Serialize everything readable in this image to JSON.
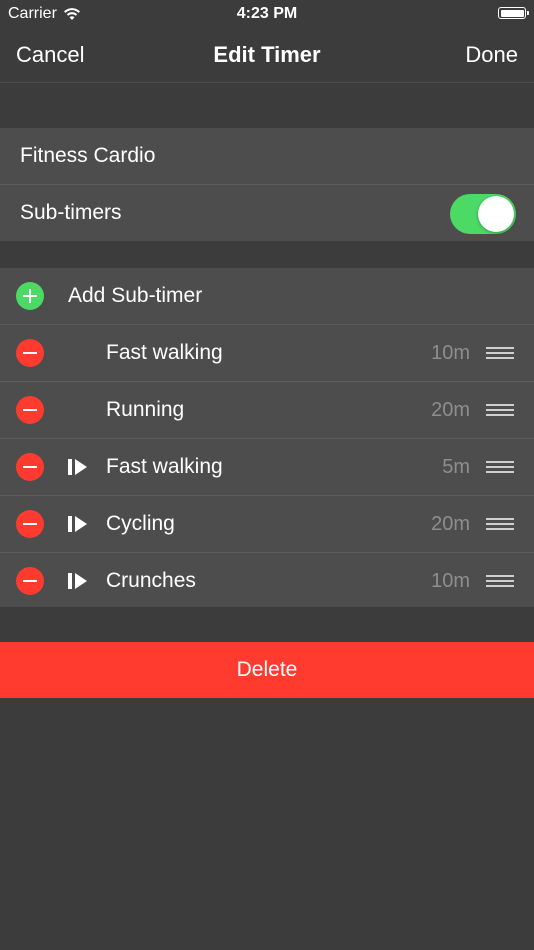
{
  "status_bar": {
    "carrier": "Carrier",
    "time": "4:23 PM"
  },
  "nav": {
    "cancel": "Cancel",
    "title": "Edit Timer",
    "done": "Done"
  },
  "settings": {
    "name": "Fitness Cardio",
    "subtimers_label": "Sub-timers",
    "subtimers_enabled": true
  },
  "subtimers": {
    "add_label": "Add Sub-timer",
    "items": [
      {
        "name": "Fast walking",
        "duration": "10m",
        "skip_icon": false
      },
      {
        "name": "Running",
        "duration": "20m",
        "skip_icon": false
      },
      {
        "name": "Fast walking",
        "duration": "5m",
        "skip_icon": true
      },
      {
        "name": "Cycling",
        "duration": "20m",
        "skip_icon": true
      },
      {
        "name": "Crunches",
        "duration": "10m",
        "skip_icon": true
      }
    ]
  },
  "delete_label": "Delete",
  "colors": {
    "accent_green": "#4cd964",
    "destructive_red": "#ff3b30",
    "background": "#3c3c3c",
    "cell": "#4d4d4d"
  }
}
